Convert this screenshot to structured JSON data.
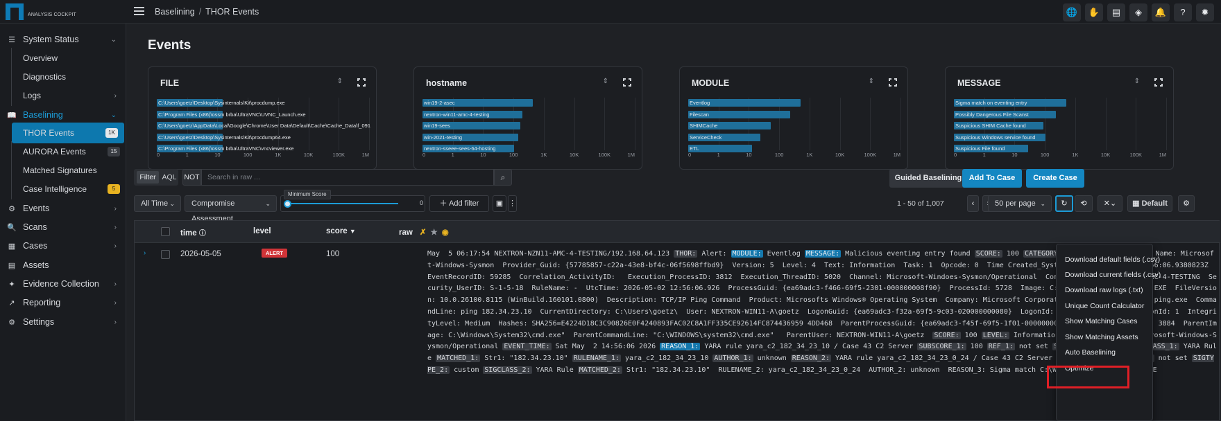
{
  "app": {
    "logo_text": "ANALYSIS COCKPIT",
    "breadcrumb": [
      "Baselining",
      "THOR Events"
    ],
    "topbar_icons": [
      {
        "name": "globe-status-icon",
        "glyph": "🌐",
        "dot": "#e8b321"
      },
      {
        "name": "user-agent-icon",
        "glyph": "✋",
        "dot": "#2fb34a"
      },
      {
        "name": "server-status-icon",
        "glyph": "▤",
        "dot": "#d13438"
      },
      {
        "name": "layers-icon",
        "glyph": "◈"
      },
      {
        "name": "bell-icon",
        "glyph": "🔔"
      },
      {
        "name": "help-icon",
        "glyph": "?"
      },
      {
        "name": "theme-toggle-icon",
        "glyph": "✹"
      }
    ]
  },
  "sidebar": {
    "items": [
      {
        "label": "System Status",
        "icon": "☰",
        "icon_name": "list-icon",
        "chev": "⌄"
      },
      {
        "label": "Overview",
        "sub": true
      },
      {
        "label": "Diagnostics",
        "sub": true
      },
      {
        "label": "Logs",
        "sub": true,
        "chev": "›"
      },
      {
        "label": "Baselining",
        "icon": "📖",
        "icon_name": "book-icon",
        "chev": "⌄",
        "active": true
      },
      {
        "label": "THOR Events",
        "sub": true,
        "badge": "1K",
        "active": true
      },
      {
        "label": "AURORA Events",
        "sub": true,
        "badge": "15"
      },
      {
        "label": "Matched Signatures",
        "sub": true
      },
      {
        "label": "Case Intelligence",
        "sub": true,
        "badge": "5",
        "badge_color": "#e8b321"
      },
      {
        "label": "Events",
        "icon": "⚙",
        "icon_name": "events-icon",
        "chev": "›"
      },
      {
        "label": "Scans",
        "icon": "🔍",
        "icon_name": "scan-icon",
        "chev": "›"
      },
      {
        "label": "Cases",
        "icon": "▦",
        "icon_name": "cases-icon",
        "chev": "›"
      },
      {
        "label": "Assets",
        "icon": "▤",
        "icon_name": "assets-icon"
      },
      {
        "label": "Evidence Collection",
        "icon": "✦",
        "icon_name": "evidence-icon",
        "chev": "›"
      },
      {
        "label": "Reporting",
        "icon": "↗",
        "icon_name": "reporting-icon",
        "chev": "›"
      },
      {
        "label": "Settings",
        "icon": "⚙",
        "icon_name": "settings-icon",
        "chev": "›"
      }
    ]
  },
  "page": {
    "title": "Events"
  },
  "cards": [
    {
      "title": "FILE",
      "bars": [
        {
          "label": "C:\\Users\\goetz\\Desktop\\Sysinternals\\Kit\\procdump.exe",
          "fraction": 0.31
        },
        {
          "label": "C:\\Program Files (x86)\\ossm brba\\UltraVNC\\UVNC_Launch.exe",
          "fraction": 0.31
        },
        {
          "label": "C:\\Users\\goetz\\AppData\\Local\\Google\\Chrome\\User Data\\Default\\Cache\\Cache_Data\\f_0918",
          "fraction": 0.31
        },
        {
          "label": "C:\\Users\\goetz\\Desktop\\Sysinternals\\Kit\\procdump64.exe",
          "fraction": 0.31
        },
        {
          "label": "C:\\Program Files (x86)\\ossm brba\\UltraVNC\\vncviewer.exe",
          "fraction": 0.31
        }
      ],
      "ticks": [
        "0",
        "1",
        "10",
        "100",
        "1K",
        "10K",
        "100K",
        "1M"
      ]
    },
    {
      "title": "hostname",
      "bars": [
        {
          "label": "win19-2-asec",
          "fraction": 0.52
        },
        {
          "label": "nextron-win11-amc-4-testing",
          "fraction": 0.47
        },
        {
          "label": "win19-sees",
          "fraction": 0.46
        },
        {
          "label": "win-2021-testing",
          "fraction": 0.45
        },
        {
          "label": "nextron-sseee-sees-64-hosting",
          "fraction": 0.43
        }
      ],
      "ticks": [
        "0",
        "1",
        "10",
        "100",
        "1K",
        "10K",
        "100K",
        "1M"
      ]
    },
    {
      "title": "MODULE",
      "bars": [
        {
          "label": "Eventlog",
          "fraction": 0.53
        },
        {
          "label": "Filescan",
          "fraction": 0.48
        },
        {
          "label": "SHIMCache",
          "fraction": 0.39
        },
        {
          "label": "ServiceCheck",
          "fraction": 0.34
        },
        {
          "label": "ETL",
          "fraction": 0.3
        }
      ],
      "ticks": [
        "0",
        "1",
        "10",
        "100",
        "1K",
        "10K",
        "100K",
        "1M"
      ]
    },
    {
      "title": "MESSAGE",
      "bars": [
        {
          "label": "Sigma match on eventing entry",
          "fraction": 0.53
        },
        {
          "label": "Possibly Dangerous File Scanst",
          "fraction": 0.48
        },
        {
          "label": "Suspicious SHIM Cache found",
          "fraction": 0.42
        },
        {
          "label": "Suspicious Windows service found",
          "fraction": 0.43
        },
        {
          "label": "Suspicious File found",
          "fraction": 0.35
        }
      ],
      "ticks": [
        "0",
        "1",
        "10",
        "100",
        "1K",
        "10K",
        "100K",
        "1M"
      ]
    }
  ],
  "filterbar": {
    "filter_label": "Filter",
    "aql_label": "AQL",
    "not_label": "NOT",
    "search_placeholder": "Search in raw ...",
    "guided_label": "Guided Baselining",
    "add_case_label": "Add To Case",
    "create_case_label": "Create Case",
    "time_range": "All Time",
    "assessment": "Compromise Assessment",
    "min_score_label": "Minimum Score",
    "min_score_value": "0",
    "add_filter_label": "Add filter",
    "page_info": "1 - 50 of 1,007",
    "per_page": "50 per page",
    "view_label": "Default"
  },
  "table": {
    "headers": {
      "time": "time",
      "level": "level",
      "score": "score",
      "raw": "raw"
    },
    "row": {
      "time": "2026-05-05",
      "level": "ALERT",
      "score": "100",
      "raw": [
        {
          "t": "May  5 06:17:54 NEXTRON-NZN11-AMC-4-TESTING/192.168.64.123 "
        },
        {
          "t": "THOR:",
          "k": 1
        },
        {
          "t": " Alert: "
        },
        {
          "t": "MODULE:",
          "k": 2
        },
        {
          "t": " Eventlog "
        },
        {
          "t": "MESSAGE:",
          "k": 2
        },
        {
          "t": " Malicious eventing entry found "
        },
        {
          "t": "SCORE:",
          "k": 1
        },
        {
          "t": " 100 "
        },
        {
          "t": "CATEGORY:",
          "k": 1
        },
        {
          "t": " EventID: 1  Provider_Name: Microsoft-Windows-Sysmon  Provider_Guid: {57785857-c22a-43e8-bf4c-06f5698ffbd9}  Version: 5  Level: 4  Text: Information  Task: 1  Opcode: 0  Time Created_SystemTime: 2026-05-02T12:56:06.9380823Z  EventRecordID: 59285  Correlation_ActivityID:   Execution_ProcessID: 3812  Execution_ThreadID: 5020  Channel: Microsoft-Windoes-Sysmon/Operational  Computer: NEXTRON-NIN11-ARC-4-TESTING  Security_UserID: S-1-5-18  RuleName: -  UtcTime: 2026-05-02 12:56:06.926  ProcessGuid: {ea69adc3-f466-69f5-2301-000000008f90}  ProcessId: 5728  Image: C:\\Windows\\System32\\PING.EXE  FileVersion: 10.0.26100.8115 (WinBuild.160101.0800)  Description: TCP/IP Ping Command  Product: Microsofts Windows® Operating System  Company: Microsoft Corporation  OriginalFileName: ping.exe  CommandLine: ping 182.34.23.10  CurrentDirectory: C:\\Users\\goetz\\  User: NEXTRON-WIN11-A\\goetz  LogonGuid: {ea69adc3-f32a-69f5-9c03-020000000080}  LogonId: 0x2839c  TerminalSessionId: 1  IntegrityLevel: Medium  Hashes: SHA256=E4224D18C3C90826E0F4240893FAC02C8A1FF335CE92614FC874436959 4DD468  ParentProcessGuid: {ea69adc3-f45f-69f5-1f01-000000008f8f}  ParentProcessId: 3884  ParentImage: C:\\Windows\\System32\\cmd.exe\"  ParentCommandLine: \"C:\\WINDOWS\\system32\\cmd.exe\"   ParentUser: NEXTRON-WIN11-A\\goetz  "
        },
        {
          "t": "SCORE:",
          "k": 1
        },
        {
          "t": " 100 "
        },
        {
          "t": "LEVEL:",
          "k": 1
        },
        {
          "t": " Informationen "
        },
        {
          "t": "EVENT_CHANNEL:",
          "k": 1
        },
        {
          "t": " Microsoft-Windows-Sysmon/Operational "
        },
        {
          "t": "EVENT_TIME:",
          "k": 1
        },
        {
          "t": " Sat May  2 14:56:06 2026 "
        },
        {
          "t": "REASON_1:",
          "k": 2
        },
        {
          "t": " YARA rule yara_c2_182_34_23_10 / Case 43 C2 Server "
        },
        {
          "t": "SUBSCORE_1:",
          "k": 1
        },
        {
          "t": " 100 "
        },
        {
          "t": "REF_1:",
          "k": 1
        },
        {
          "t": " not set "
        },
        {
          "t": "SIGTYPE_1:",
          "k": 1
        },
        {
          "t": " custom "
        },
        {
          "t": "SIGCLASS_1:",
          "k": 1
        },
        {
          "t": " YARA Rule "
        },
        {
          "t": "MATCHED_1:",
          "k": 1
        },
        {
          "t": " Str1: \"182.34.23.10\" "
        },
        {
          "t": "RULENAME_1:",
          "k": 1
        },
        {
          "t": " yara_c2_182_34_23_10 "
        },
        {
          "t": "AUTHOR_1:",
          "k": 1
        },
        {
          "t": " unknown "
        },
        {
          "t": "REASON_2:",
          "k": 1
        },
        {
          "t": " YARA rule yara_c2_182_34_23_0_24 / Case 43 C2 Server "
        },
        {
          "t": "SUBSCORE_2:",
          "k": 1
        },
        {
          "t": " 100 "
        },
        {
          "t": "REF_2:",
          "k": 1
        },
        {
          "t": " not set "
        },
        {
          "t": "SIGTYPE_2:",
          "k": 1
        },
        {
          "t": " custom "
        },
        {
          "t": "SIGCLASS_2:",
          "k": 1
        },
        {
          "t": " YARA Rule "
        },
        {
          "t": "MATCHED_2:",
          "k": 1
        },
        {
          "t": " Str1: \"182.34.23.10\"  RULENAME_2: yara_c2_182_34_23_0_24  AUTHOR_2: unknown  REASON_3: Sigma match C:\\Windows\\System32\\PING.EXE  "
        }
      ]
    }
  },
  "menu": {
    "items": [
      "Download default fields (.csv)",
      "Download current fields (.csv)",
      "Download raw logs (.txt)",
      "Unique Count Calculator",
      "Show Matching Cases",
      "Show Matching Assets",
      "Auto Baselining",
      "Optimize"
    ]
  },
  "colors": {
    "accent": "#1487c2",
    "alert": "#d13438",
    "highlight": "#e01f26",
    "badge_yellow": "#e8b321"
  }
}
